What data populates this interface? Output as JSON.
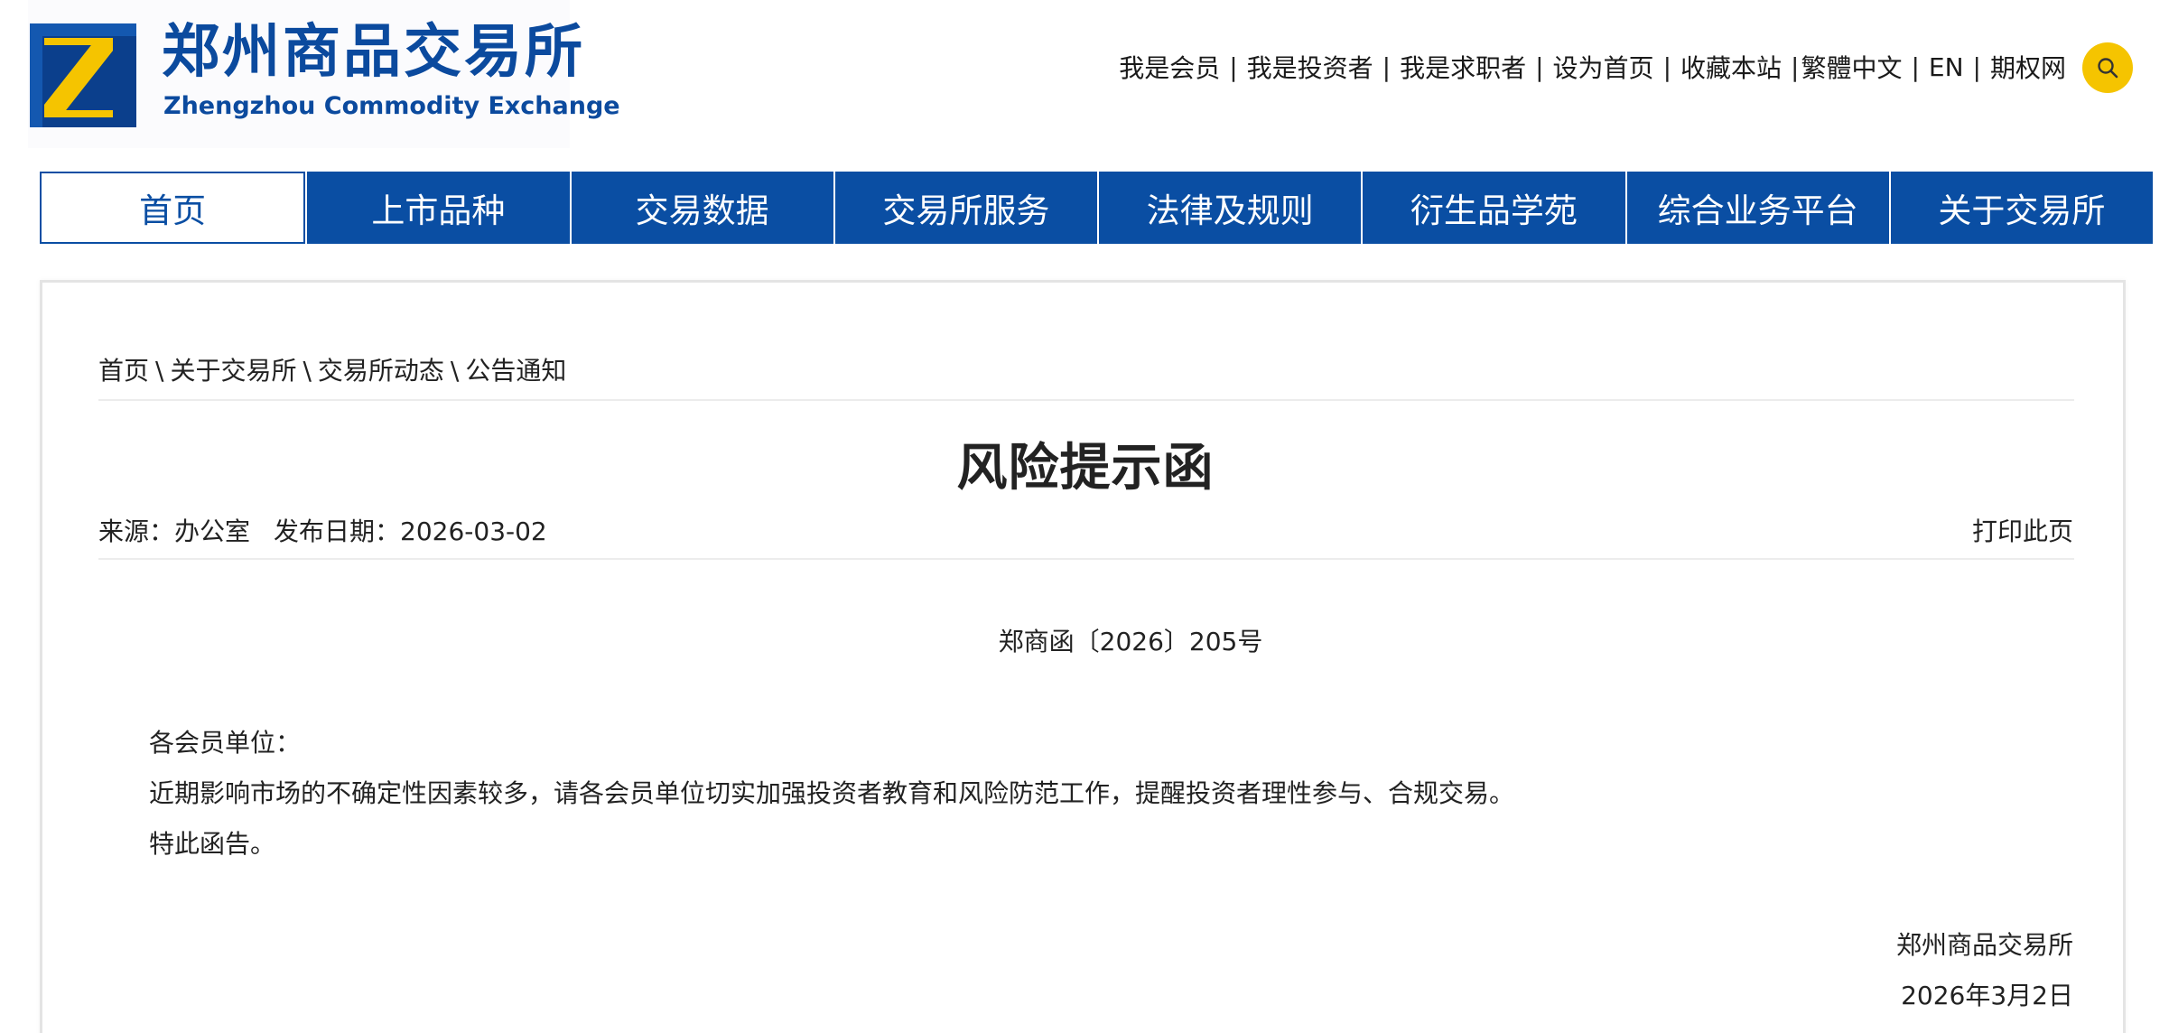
{
  "header": {
    "logo_cn": "郑州商品交易所",
    "logo_en": "Zhengzhou Commodity Exchange",
    "toplinks": [
      "我是会员",
      "我是投资者",
      "我是求职者",
      "设为首页",
      "收藏本站",
      "繁體中文",
      "EN",
      "期权网"
    ],
    "search_icon": "search-icon"
  },
  "colors": {
    "brand_blue": "#0a4ea3",
    "accent_yellow": "#f5c400"
  },
  "nav": {
    "items": [
      "首页",
      "上市品种",
      "交易数据",
      "交易所服务",
      "法律及规则",
      "衍生品学苑",
      "综合业务平台",
      "关于交易所"
    ],
    "active": "首页"
  },
  "breadcrumb": [
    "首页",
    "关于交易所",
    "交易所动态",
    "公告通知"
  ],
  "breadcrumb_sep": "\\",
  "article": {
    "title": "风险提示函",
    "source": "来源：办公室",
    "date": "发布日期：2026-03-02",
    "print_label": "打印此页",
    "doc_number": "郑商函〔2026〕205号",
    "salutation": "各会员单位：",
    "paragraph": "近期影响市场的不确定性因素较多，请各会员单位切实加强投资者教育和风险防范工作，提醒投资者理性参与、合规交易。",
    "closing": "特此函告。",
    "signature": "郑州商品交易所",
    "sign_date": "2026年3月2日"
  }
}
